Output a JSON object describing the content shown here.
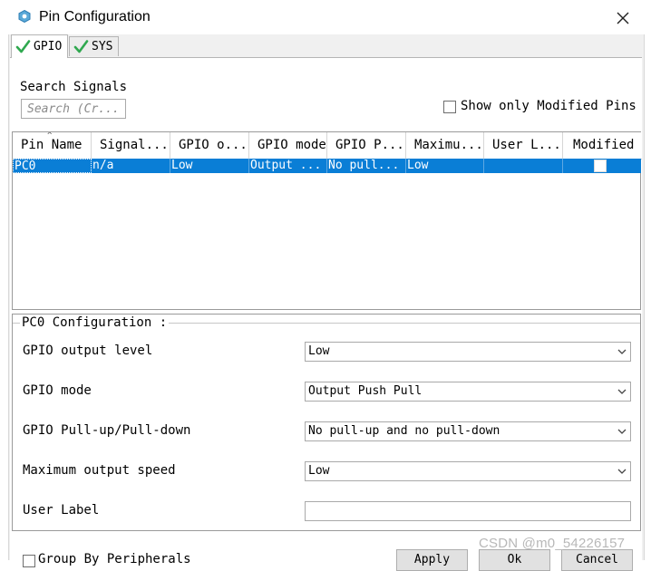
{
  "window": {
    "title": "Pin Configuration"
  },
  "tabs": [
    {
      "label": "GPIO",
      "active": true
    },
    {
      "label": "SYS",
      "active": false
    }
  ],
  "search": {
    "label": "Search Signals",
    "placeholder": "Search (Cr..."
  },
  "filter": {
    "label": "Show only Modified Pins",
    "checked": false
  },
  "table": {
    "columns": [
      "Pin Name",
      "Signal...",
      "GPIO o...",
      "GPIO mode",
      "GPIO P...",
      "Maximu...",
      "User L...",
      "Modified"
    ],
    "rows": [
      {
        "cells": [
          "PC0",
          "n/a",
          "Low",
          "Output ...",
          "No pull...",
          "Low",
          ""
        ],
        "modified": false
      }
    ]
  },
  "config": {
    "title": "PC0 Configuration :",
    "fields": [
      {
        "label": "GPIO output level",
        "value": "Low"
      },
      {
        "label": "GPIO mode",
        "value": "Output Push Pull"
      },
      {
        "label": "GPIO Pull-up/Pull-down",
        "value": "No pull-up and no pull-down"
      },
      {
        "label": "Maximum output speed",
        "value": "Low"
      }
    ],
    "user_label": {
      "label": "User Label",
      "value": ""
    }
  },
  "footer": {
    "group_label": "Group By Peripherals",
    "apply_label": "Apply",
    "ok_label": "Ok",
    "cancel_label": "Cancel"
  },
  "watermark": "CSDN @m0_54226157",
  "colors": {
    "selection": "#0a7ed6",
    "check": "#2fa84f",
    "background": "#f0f0f0"
  },
  "icons": {
    "app": "hexagon-icon",
    "close": "close-icon",
    "tab_check": "check-icon",
    "dropdown": "chevron-down-icon"
  }
}
